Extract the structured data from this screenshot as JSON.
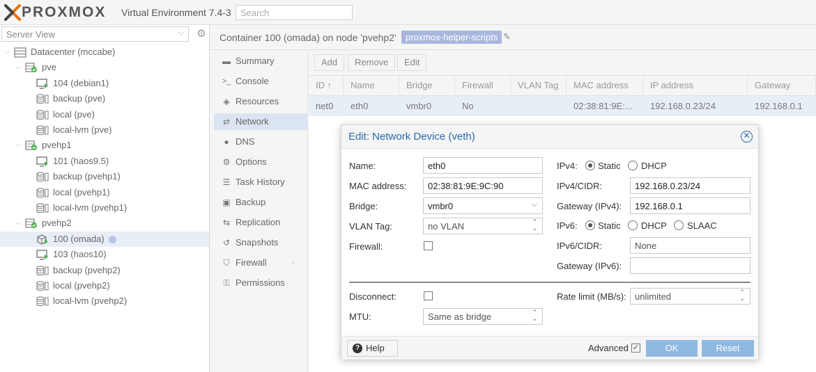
{
  "header": {
    "logo_text": "PROXMOX",
    "product": "Virtual Environment 7.4-3",
    "search_placeholder": "Search"
  },
  "left": {
    "view_select": "Server View",
    "tree": [
      {
        "label": "Datacenter (mccabe)",
        "icon": "datacenter-icon"
      },
      {
        "label": "pve",
        "icon": "node-icon"
      },
      {
        "label": "104 (debian1)",
        "icon": "vm-icon"
      },
      {
        "label": "backup (pve)",
        "icon": "storage-icon"
      },
      {
        "label": "local (pve)",
        "icon": "storage-icon"
      },
      {
        "label": "local-lvm (pve)",
        "icon": "storage-icon"
      },
      {
        "label": "pvehp1",
        "icon": "node-icon"
      },
      {
        "label": "101 (haos9.5)",
        "icon": "vm-icon"
      },
      {
        "label": "backup (pvehp1)",
        "icon": "storage-icon"
      },
      {
        "label": "local (pvehp1)",
        "icon": "storage-icon"
      },
      {
        "label": "local-lvm (pvehp1)",
        "icon": "storage-icon"
      },
      {
        "label": "pvehp2",
        "icon": "node-icon"
      },
      {
        "label": "100 (omada)",
        "icon": "container-icon"
      },
      {
        "label": "103 (haos10)",
        "icon": "vm-icon"
      },
      {
        "label": "backup (pvehp2)",
        "icon": "storage-icon"
      },
      {
        "label": "local (pvehp2)",
        "icon": "storage-icon"
      },
      {
        "label": "local-lvm (pvehp2)",
        "icon": "storage-icon"
      }
    ]
  },
  "content": {
    "title": "Container 100 (omada) on node 'pvehp2'",
    "tag": "proxmox-helper-scripts"
  },
  "menu": [
    {
      "label": "Summary",
      "icon": "book-icon"
    },
    {
      "label": "Console",
      "icon": "terminal-icon"
    },
    {
      "label": "Resources",
      "icon": "cube-icon"
    },
    {
      "label": "Network",
      "icon": "exchange-icon"
    },
    {
      "label": "DNS",
      "icon": "globe-icon"
    },
    {
      "label": "Options",
      "icon": "gear-icon"
    },
    {
      "label": "Task History",
      "icon": "list-icon"
    },
    {
      "label": "Backup",
      "icon": "floppy-icon"
    },
    {
      "label": "Replication",
      "icon": "retweet-icon"
    },
    {
      "label": "Snapshots",
      "icon": "history-icon"
    },
    {
      "label": "Firewall",
      "icon": "shield-icon"
    },
    {
      "label": "Permissions",
      "icon": "unlock-icon"
    }
  ],
  "toolbar": {
    "add": "Add",
    "remove": "Remove",
    "edit": "Edit"
  },
  "grid": {
    "columns": [
      "ID ↑",
      "Name",
      "Bridge",
      "Firewall",
      "VLAN Tag",
      "MAC address",
      "IP address",
      "Gateway"
    ],
    "rows": [
      [
        "net0",
        "eth0",
        "vmbr0",
        "No",
        "",
        "02:38:81:9E:...",
        "192.168.0.23/24",
        "192.168.0.1"
      ]
    ]
  },
  "dialog": {
    "title": "Edit: Network Device (veth)",
    "name_label": "Name:",
    "name_value": "eth0",
    "mac_label": "MAC address:",
    "mac_value": "02:38:81:9E:9C:90",
    "bridge_label": "Bridge:",
    "bridge_value": "vmbr0",
    "vlan_label": "VLAN Tag:",
    "vlan_value": "no VLAN",
    "firewall_label": "Firewall:",
    "ipv4_label": "IPv4:",
    "static": "Static",
    "dhcp": "DHCP",
    "slaac": "SLAAC",
    "ipv4cidr_label": "IPv4/CIDR:",
    "ipv4cidr_value": "192.168.0.23/24",
    "gw4_label": "Gateway (IPv4):",
    "gw4_value": "192.168.0.1",
    "ipv6_label": "IPv6:",
    "ipv6cidr_label": "IPv6/CIDR:",
    "ipv6cidr_value": "None",
    "gw6_label": "Gateway (IPv6):",
    "gw6_value": "",
    "disconnect_label": "Disconnect:",
    "mtu_label": "MTU:",
    "mtu_value": "Same as bridge",
    "rate_label": "Rate limit (MB/s):",
    "rate_value": "unlimited",
    "help": "Help",
    "advanced": "Advanced",
    "ok": "OK",
    "reset": "Reset"
  },
  "colors": {
    "accent": "#2a6aa8",
    "tag": "#a9b7de",
    "primary_button": "#8fb9e1",
    "selection": "#e8eef6"
  }
}
